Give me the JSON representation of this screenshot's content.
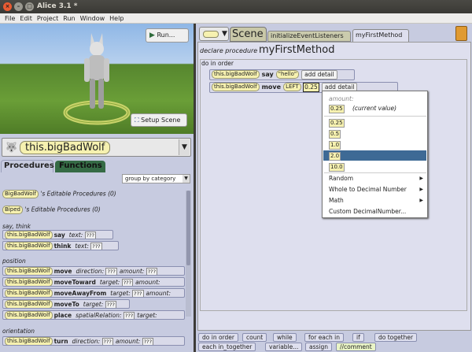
{
  "window": {
    "title": "Alice 3.1 *"
  },
  "menu": [
    "File",
    "Edit",
    "Project",
    "Run",
    "Window",
    "Help"
  ],
  "scene_view": {
    "run_label": "Run...",
    "setup_label": "Setup Scene"
  },
  "selector": {
    "object": "this.bigBadWolf"
  },
  "tabs": {
    "procedures": "Procedures",
    "functions": "Functions"
  },
  "group_by": "group by category",
  "editable": [
    {
      "object": "BigBadWolf",
      "suffix": "'s Editable Procedures (0)"
    },
    {
      "object": "Biped",
      "suffix": "'s Editable Procedures (0)"
    }
  ],
  "categories": {
    "say_think": "say, think",
    "position": "position",
    "orientation": "orientation"
  },
  "procs": [
    {
      "obj": "this.bigBadWolf",
      "name": "say",
      "p1": "text:",
      "v1": "???",
      "p2": "",
      "v2": ""
    },
    {
      "obj": "this.bigBadWolf",
      "name": "think",
      "p1": "text:",
      "v1": "???",
      "p2": "",
      "v2": ""
    },
    {
      "obj": "this.bigBadWolf",
      "name": "move",
      "p1": "direction:",
      "v1": "???",
      "p2": "amount:",
      "v2": "???"
    },
    {
      "obj": "this.bigBadWolf",
      "name": "moveToward",
      "p1": "target:",
      "v1": "???",
      "p2": "amount:",
      "v2": ""
    },
    {
      "obj": "this.bigBadWolf",
      "name": "moveAwayFrom",
      "p1": "target:",
      "v1": "???",
      "p2": "amount:",
      "v2": ""
    },
    {
      "obj": "this.bigBadWolf",
      "name": "moveTo",
      "p1": "target:",
      "v1": "???",
      "p2": "",
      "v2": ""
    },
    {
      "obj": "this.bigBadWolf",
      "name": "place",
      "p1": "spatialRelation:",
      "v1": "???",
      "p2": "target:",
      "v2": ""
    },
    {
      "obj": "this.bigBadWolf",
      "name": "turn",
      "p1": "direction:",
      "v1": "???",
      "p2": "amount:",
      "v2": "???"
    }
  ],
  "editor_tabs": {
    "scene": "Scene",
    "init": "initializeEventListeners",
    "method": "myFirstMethod"
  },
  "declaration": {
    "label": "declare procedure",
    "name": "myFirstMethod"
  },
  "do_in_order": "do in order",
  "statements": [
    {
      "obj": "this.bigBadWolf",
      "method": "say",
      "arg": "\"hello\"",
      "add": "add detail"
    },
    {
      "obj": "this.bigBadWolf",
      "method": "move",
      "arg": "LEFT",
      "arg2": "0.25",
      "add": "add detail"
    }
  ],
  "popup": {
    "amount_label": "amount:",
    "current_value": "0.25",
    "current_label": "(current value)",
    "options": [
      "0.25",
      "0.5",
      "1.0",
      "2.0",
      "10.0"
    ],
    "selected": "2.0",
    "submenus": [
      "Random",
      "Whole to Decimal Number",
      "Math"
    ],
    "custom": "Custom DecimalNumber...",
    "highlight_color": "#3e6a95"
  },
  "bottom_toolbar": [
    "do in order",
    "count",
    "while",
    "for each in",
    "if",
    "do together",
    "each in_together",
    "variable...",
    "assign",
    "//comment"
  ]
}
